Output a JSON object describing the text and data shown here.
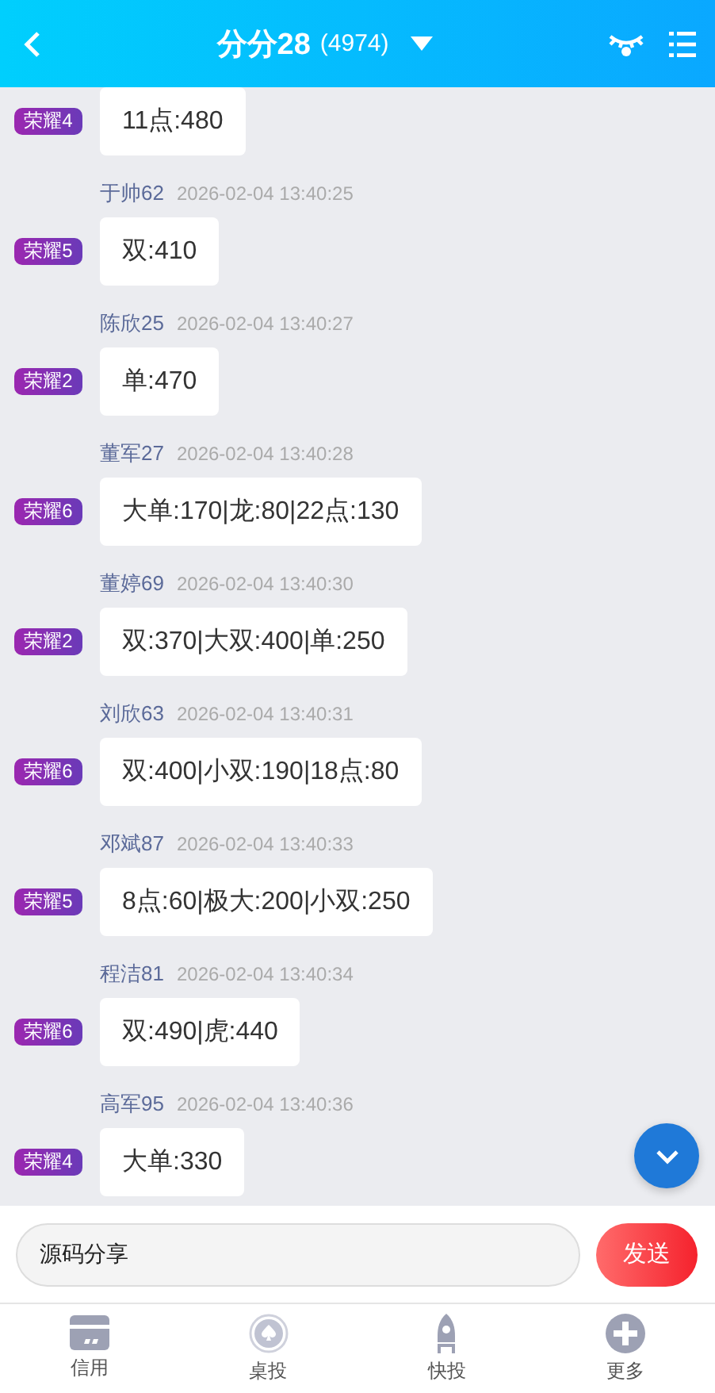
{
  "header": {
    "title": "分分28",
    "count": "(4974)"
  },
  "messages": [
    {
      "badge": "荣耀4",
      "text": "11点:480"
    },
    {
      "name": "于帅62",
      "time": "2026-02-04 13:40:25",
      "badge": "荣耀5",
      "text": "双:410"
    },
    {
      "name": "陈欣25",
      "time": "2026-02-04 13:40:27",
      "badge": "荣耀2",
      "text": "单:470"
    },
    {
      "name": "董军27",
      "time": "2026-02-04 13:40:28",
      "badge": "荣耀6",
      "text": "大单:170|龙:80|22点:130"
    },
    {
      "name": "董婷69",
      "time": "2026-02-04 13:40:30",
      "badge": "荣耀2",
      "text": "双:370|大双:400|单:250"
    },
    {
      "name": "刘欣63",
      "time": "2026-02-04 13:40:31",
      "badge": "荣耀6",
      "text": "双:400|小双:190|18点:80"
    },
    {
      "name": "邓斌87",
      "time": "2026-02-04 13:40:33",
      "badge": "荣耀5",
      "text": "8点:60|极大:200|小双:250"
    },
    {
      "name": "程洁81",
      "time": "2026-02-04 13:40:34",
      "badge": "荣耀6",
      "text": "双:490|虎:440"
    },
    {
      "name": "高军95",
      "time": "2026-02-04 13:40:36",
      "badge": "荣耀4",
      "text": "大单:330"
    }
  ],
  "composer": {
    "value": "源码分享",
    "send": "发送"
  },
  "tabs": [
    {
      "kind": "card",
      "label": "信用"
    },
    {
      "kind": "spade",
      "label": "桌投"
    },
    {
      "kind": "rocket",
      "label": "快投"
    },
    {
      "kind": "plus",
      "label": "更多"
    }
  ]
}
